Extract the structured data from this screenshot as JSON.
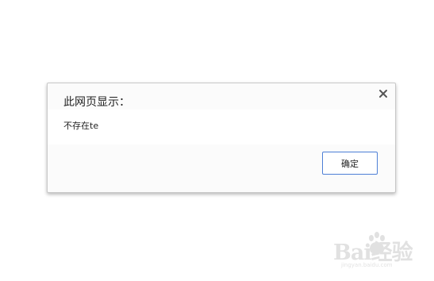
{
  "dialog": {
    "title": "此网页显示：",
    "message": "不存在te",
    "ok_label": "确定",
    "close_icon": "close-icon"
  },
  "watermark": {
    "brand": "Bai经验",
    "url": "jingyan.baidu.com",
    "paw_icon": "baidu-paw-icon"
  },
  "colors": {
    "button_border": "#4d7fd6",
    "dialog_bg": "#fbfbfb",
    "text": "#222222"
  }
}
